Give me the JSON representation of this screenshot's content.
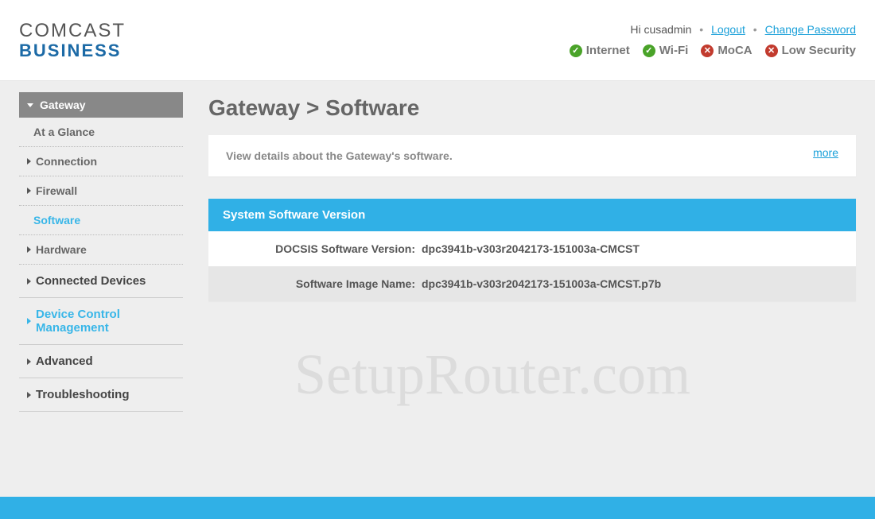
{
  "brand": {
    "line1": "COMCAST",
    "line2": "BUSINESS"
  },
  "user_bar": {
    "greeting": "Hi cusadmin",
    "logout": "Logout",
    "change_password": "Change Password"
  },
  "status": {
    "items": [
      {
        "label": "Internet",
        "ok": true
      },
      {
        "label": "Wi-Fi",
        "ok": true
      },
      {
        "label": "MoCA",
        "ok": false
      },
      {
        "label": "Low Security",
        "ok": false
      }
    ]
  },
  "sidebar": {
    "gateway": "Gateway",
    "at_a_glance": "At a Glance",
    "connection": "Connection",
    "firewall": "Firewall",
    "software": "Software",
    "hardware": "Hardware",
    "connected_devices": "Connected Devices",
    "device_control": "Device Control Management",
    "advanced": "Advanced",
    "troubleshooting": "Troubleshooting"
  },
  "main": {
    "title": "Gateway > Software",
    "description": "View details about the Gateway's software.",
    "more": "more",
    "panel_title": "System Software Version",
    "rows": [
      {
        "label": "DOCSIS Software Version:",
        "value": "dpc3941b-v303r2042173-151003a-CMCST"
      },
      {
        "label": "Software Image Name:",
        "value": "dpc3941b-v303r2042173-151003a-CMCST.p7b"
      }
    ]
  },
  "watermark": "SetupRouter.com"
}
